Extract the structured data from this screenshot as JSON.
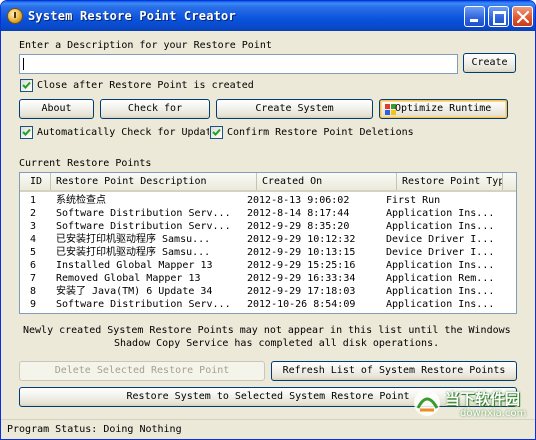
{
  "window": {
    "title": "System Restore Point Creator"
  },
  "description": {
    "label": "Enter a Description for your Restore Point",
    "value": "",
    "create_label": "Create"
  },
  "close_after": {
    "label": "Close after Restore Point is created",
    "checked": true
  },
  "buttons": {
    "about": "About",
    "check_for": "Check for",
    "create_system": "Create System",
    "optimize_runtime": "Optimize Runtime"
  },
  "auto_check": {
    "label": "Automatically Check for Updat",
    "checked": true
  },
  "confirm_delete": {
    "label": "Confirm Restore Point Deletions",
    "checked": true
  },
  "restore_points": {
    "heading": "Current Restore Points",
    "columns": [
      "ID",
      "Restore Point Description",
      "Created On",
      "Restore Point Type"
    ],
    "rows": [
      {
        "id": "1",
        "description": "系统检查点",
        "created": "2012-8-13 9:06:02",
        "type": "First Run"
      },
      {
        "id": "2",
        "description": "Software Distribution Serv...",
        "created": "2012-8-14 8:17:44",
        "type": "Application Ins..."
      },
      {
        "id": "3",
        "description": "Software Distribution Serv...",
        "created": "2012-9-29 8:35:20",
        "type": "Application Ins..."
      },
      {
        "id": "4",
        "description": "已安装打印机驱动程序 Samsu...",
        "created": "2012-9-29 10:12:32",
        "type": "Device Driver I..."
      },
      {
        "id": "5",
        "description": "已安装打印机驱动程序 Samsu...",
        "created": "2012-9-29 10:13:15",
        "type": "Device Driver I..."
      },
      {
        "id": "6",
        "description": "Installed Global Mapper 13",
        "created": "2012-9-29 15:25:16",
        "type": "Application Ins..."
      },
      {
        "id": "7",
        "description": "Removed Global Mapper 13",
        "created": "2012-9-29 16:33:34",
        "type": "Application Rem..."
      },
      {
        "id": "8",
        "description": "安装了 Java(TM) 6 Update 34",
        "created": "2012-9-29 17:18:03",
        "type": "Application Ins..."
      },
      {
        "id": "9",
        "description": "Software Distribution Serv...",
        "created": "2012-10-26 8:54:09",
        "type": "Application Ins..."
      }
    ]
  },
  "notice": {
    "line1": "Newly created System Restore Points may not appear in this list until the Windows",
    "line2": "Shadow Copy Service has completed all disk operations."
  },
  "actions": {
    "delete_label": "Delete Selected Restore Point",
    "refresh_label": "Refresh List of System Restore Points",
    "restore_label": "Restore System to Selected System Restore Point"
  },
  "status": {
    "text": "Program Status: Doing Nothing"
  },
  "watermark": {
    "title": "当下软件园",
    "url": "downxia.com"
  },
  "colors": {
    "titlebar": "#0a53dd",
    "window_bg": "#ece9d8",
    "close_button": "#e05a33",
    "input_border": "#7f9db9"
  }
}
